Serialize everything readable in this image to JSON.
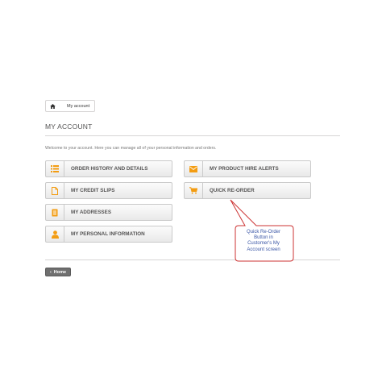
{
  "breadcrumb": {
    "home_icon": "home-icon",
    "current": "My account"
  },
  "page": {
    "title": "MY ACCOUNT",
    "intro": "Welcome to your account. Here you can manage all of your personal information and orders."
  },
  "buttons": {
    "order_history": {
      "label": "ORDER HISTORY AND DETAILS",
      "icon": "list-icon"
    },
    "credit_slips": {
      "label": "MY CREDIT SLIPS",
      "icon": "document-icon"
    },
    "addresses": {
      "label": "MY ADDRESSES",
      "icon": "address-book-icon"
    },
    "personal_info": {
      "label": "MY PERSONAL INFORMATION",
      "icon": "user-icon"
    },
    "hire_alerts": {
      "label": "MY PRODUCT HIRE ALERTS",
      "icon": "envelope-icon"
    },
    "quick_reorder": {
      "label": "QUICK RE-ORDER",
      "icon": "cart-icon"
    }
  },
  "footer": {
    "home_label": "Home",
    "home_chevron": "‹"
  },
  "callout": {
    "lines": [
      "Quick Re-Order",
      "Button in",
      "Customer's My",
      "Account screen"
    ]
  },
  "colors": {
    "accent": "#f39c11",
    "callout_border": "#cc3333",
    "callout_text": "#3a56a6"
  }
}
